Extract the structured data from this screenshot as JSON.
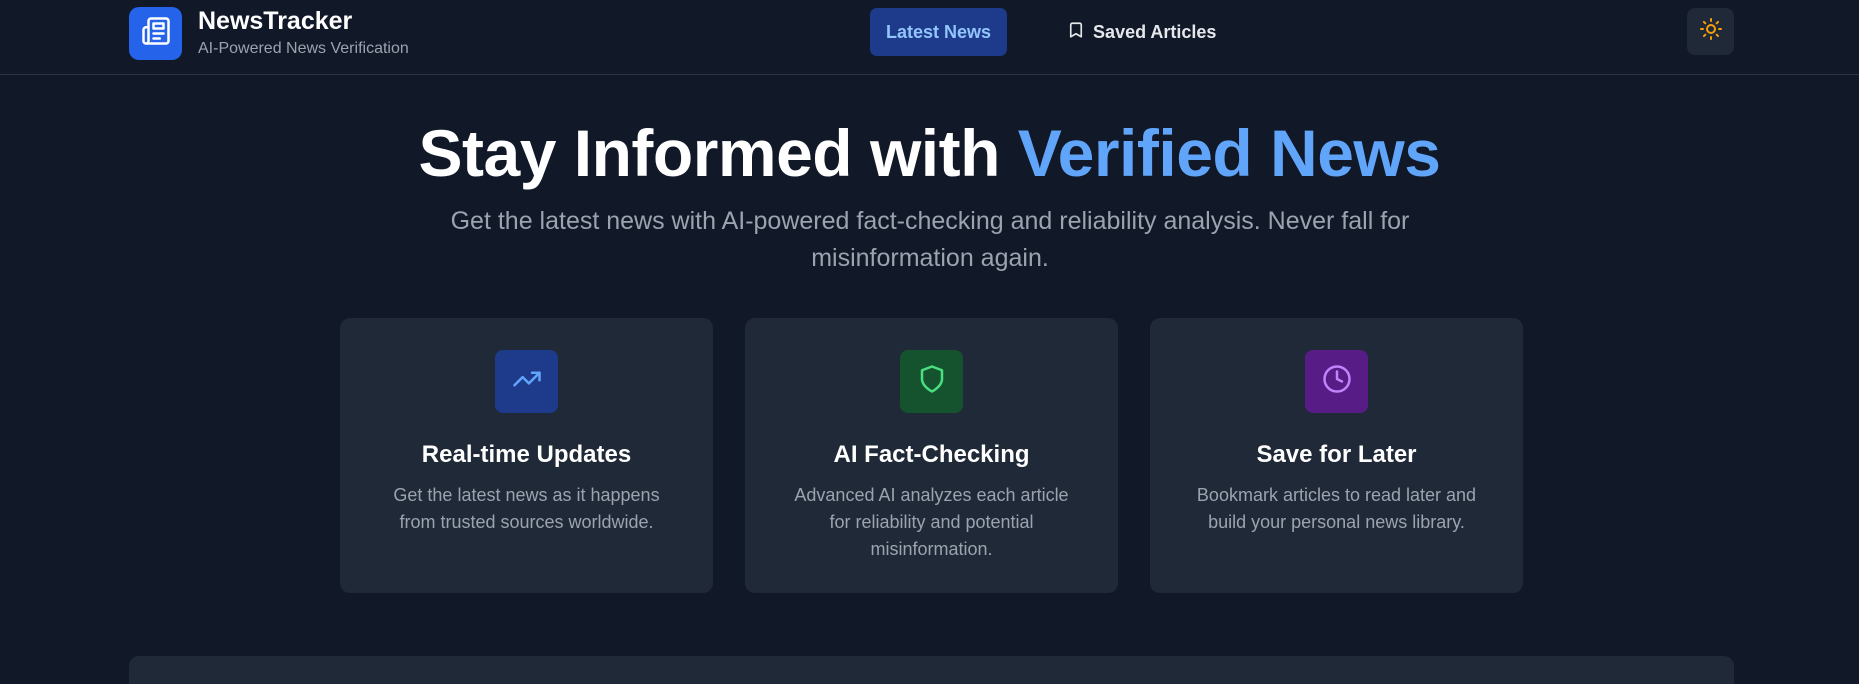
{
  "brand": {
    "title": "NewsTracker",
    "subtitle": "AI-Powered News Verification",
    "icon": "newspaper-icon",
    "color": "#2563eb"
  },
  "nav": {
    "items": [
      {
        "label": "Latest News",
        "active": true
      },
      {
        "label": "Saved Articles",
        "icon": "bookmark-icon",
        "active": false
      }
    ]
  },
  "theme_toggle": {
    "icon": "sun-icon",
    "color": "#f59e0b"
  },
  "hero": {
    "title_main": "Stay Informed with",
    "title_accent": "Verified News",
    "subtitle": "Get the latest news with AI-powered fact-checking and reliability analysis. Never fall for misinformation again.",
    "accent_color": "#60a5fa"
  },
  "features": [
    {
      "title": "Real-time Updates",
      "description": "Get the latest news as it happens from trusted sources worldwide.",
      "icon": "trending-up-icon",
      "icon_bg": "#1e3a8a",
      "icon_color": "#60a5fa"
    },
    {
      "title": "AI Fact-Checking",
      "description": "Advanced AI analyzes each article for reliability and potential misinformation.",
      "icon": "shield-icon",
      "icon_bg": "#14532d",
      "icon_color": "#4ade80"
    },
    {
      "title": "Save for Later",
      "description": "Bookmark articles to read later and build your personal news library.",
      "icon": "clock-icon",
      "icon_bg": "#581c87",
      "icon_color": "#c084fc"
    }
  ]
}
